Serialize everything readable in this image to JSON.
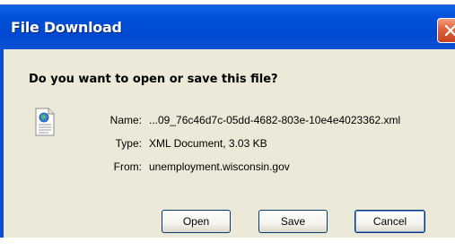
{
  "dialog": {
    "title": "File Download",
    "question": "Do you want to open or save this file?",
    "file": {
      "name_label": "Name:",
      "name_value": "...09_76c46d7c-05dd-4682-803e-10e4e4023362.xml",
      "type_label": "Type:",
      "type_value": "XML Document, 3.03 KB",
      "from_label": "From:",
      "from_value": "unemployment.wisconsin.gov"
    },
    "buttons": {
      "open": "Open",
      "save": "Save",
      "cancel": "Cancel"
    }
  },
  "colors": {
    "titlebar": "#0050d8",
    "body": "#ece9d8",
    "close_button": "#e06640",
    "button_border": "#003c74"
  },
  "icons": {
    "close": "close-icon",
    "file": "xml-document-icon"
  }
}
